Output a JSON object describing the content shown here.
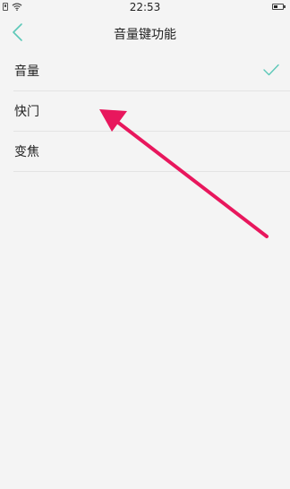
{
  "status_bar": {
    "time": "22:53",
    "icons": [
      "sim-card-icon",
      "wifi-icon",
      "battery-icon"
    ]
  },
  "header": {
    "title": "音量键功能",
    "back_icon": "chevron-left-icon"
  },
  "options": [
    {
      "label": "音量",
      "selected": true
    },
    {
      "label": "快门",
      "selected": false
    },
    {
      "label": "变焦",
      "selected": false
    }
  ],
  "colors": {
    "accent": "#5cc8b8",
    "annotation_arrow": "#e8175d",
    "background": "#f4f4f4",
    "divider": "#e3e3e3"
  }
}
